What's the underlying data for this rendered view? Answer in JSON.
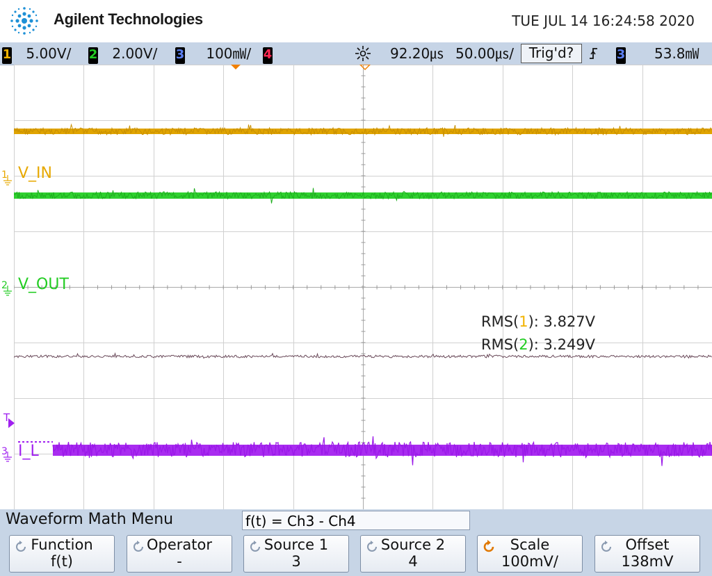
{
  "header": {
    "brand": "Agilent Technologies",
    "datetime": "TUE JUL 14 16:24:58 2020"
  },
  "status_bar": {
    "ch1": {
      "num": "1",
      "scale": "5.00V/",
      "color": "#f2b300"
    },
    "ch2": {
      "num": "2",
      "scale": "2.00V/",
      "color": "#22cc22"
    },
    "ch3": {
      "num": "3",
      "scale": "100㎽/",
      "color": "#3a63d8"
    },
    "ch4": {
      "num": "4",
      "color": "#ff2a55"
    },
    "time_delay": "92.20㎲",
    "time_scale": "50.00㎲/",
    "trigger_status": "Trig'd?",
    "trigger_source": "3",
    "trigger_level": "53.8㎽"
  },
  "waveforms": {
    "ch1": {
      "marker": "1",
      "label": "V_IN",
      "color": "#e7a800"
    },
    "ch2": {
      "marker": "2",
      "label": "V_OUT",
      "color": "#22cc22"
    },
    "ch3": {
      "marker": "3",
      "label": "I_L",
      "color": "#a020f0"
    },
    "trigger_marker": "T"
  },
  "measurements": [
    {
      "prefix": "RMS(",
      "channel": "1",
      "suffix": "): 3.827V",
      "color": "#f2b300"
    },
    {
      "prefix": "RMS(",
      "channel": "2",
      "suffix": "): 3.249V",
      "color": "#22cc22"
    }
  ],
  "menu": {
    "title": "Waveform Math Menu",
    "formula": "f(t) = Ch3 - Ch4",
    "softkeys": [
      {
        "label": "Function",
        "value": "f(t)"
      },
      {
        "label": "Operator",
        "value": "-"
      },
      {
        "label": "Source 1",
        "value": "3"
      },
      {
        "label": "Source 2",
        "value": "4"
      },
      {
        "label": "Scale",
        "value": "100mV/"
      },
      {
        "label": "Offset",
        "value": "138mV"
      }
    ]
  }
}
